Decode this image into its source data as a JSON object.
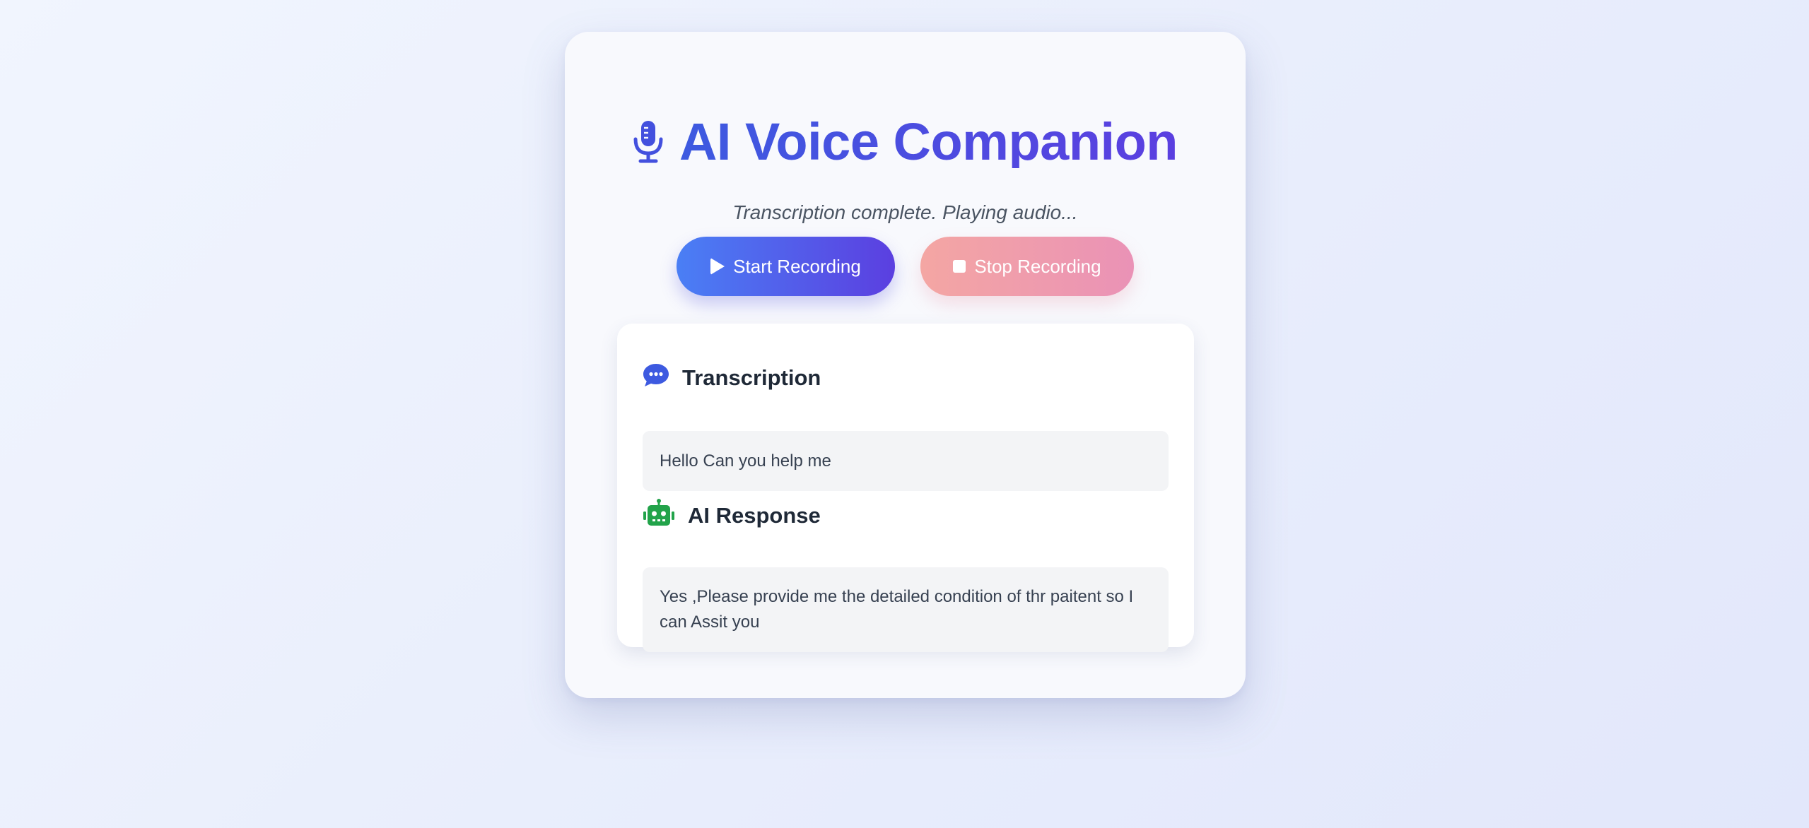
{
  "app": {
    "title": "AI Voice Companion",
    "status": "Transcription complete. Playing audio...",
    "icon": "microphone-icon"
  },
  "controls": {
    "start_label": "Start Recording",
    "start_icon": "play-icon",
    "stop_label": "Stop Recording",
    "stop_icon": "stop-icon"
  },
  "transcription": {
    "heading": "Transcription",
    "icon": "chat-bubble-icon",
    "text": "Hello Can you help me"
  },
  "response": {
    "heading": "AI Response",
    "icon": "robot-icon",
    "text": "Yes ,Please provide me the detailed condition of thr paitent so I can Assit you"
  },
  "colors": {
    "accent_start": "#4a7ff5",
    "accent_end": "#5b3fe0",
    "stop_start": "#f4a6a3",
    "stop_end": "#ea92b6",
    "robot_green": "#22a34a",
    "chat_blue": "#3d5ae0"
  }
}
